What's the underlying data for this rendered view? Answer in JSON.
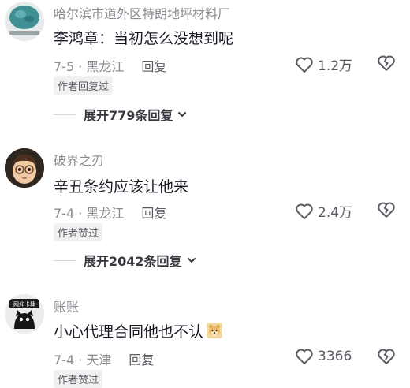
{
  "comments": [
    {
      "username": "哈尔滨市道外区特朗地坪材料厂",
      "content": "李鸿章：当初怎么没想到呢",
      "date": "7-5",
      "location": "黑龙江",
      "reply_label": "回复",
      "likes": "1.2万",
      "badge": "作者回复过",
      "expand_label": "展开779条回复",
      "avatar": "teal-floor-material-avatar"
    },
    {
      "username": "破界之刃",
      "content": "辛丑条约应该让他来",
      "date": "7-4",
      "location": "黑龙江",
      "reply_label": "回复",
      "likes": "2.4万",
      "badge": "作者赞过",
      "expand_label": "展开2042条回复",
      "avatar": "cartoon-boy-avatar"
    },
    {
      "username": "账账",
      "content": "小心代理合同他也不认",
      "date": "7-4",
      "location": "天津",
      "reply_label": "回复",
      "likes": "3366",
      "badge": "作者赞过",
      "avatar": "black-cat-avatar",
      "avatar_text": "网抑卡肆"
    }
  ],
  "icons": {
    "like": "heart-outline-icon",
    "dislike": "broken-heart-icon",
    "chevron": "chevron-down-icon",
    "emoji": "doge-emoji-icon"
  },
  "colors": {
    "text_primary": "#161823",
    "text_secondary": "#8a8b91",
    "badge_bg": "#f1f1f2"
  }
}
